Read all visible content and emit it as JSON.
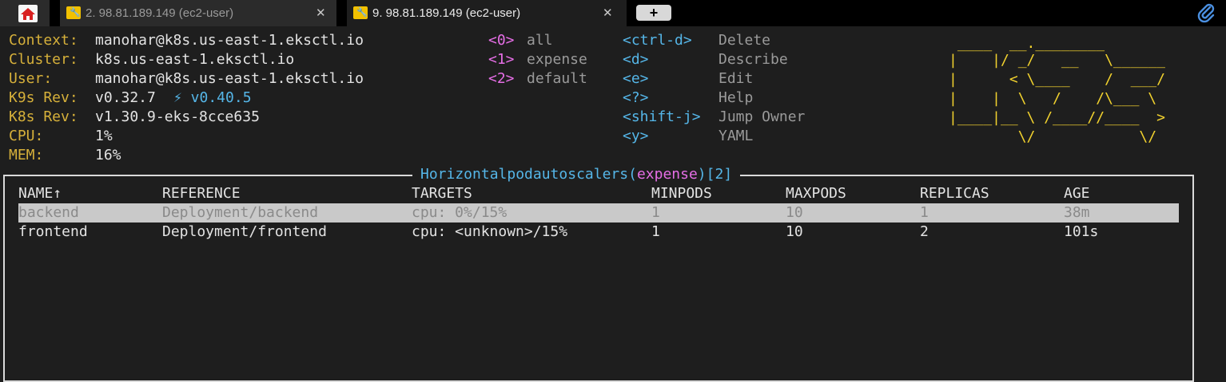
{
  "tabs": [
    {
      "label": "2. 98.81.189.149 (ec2-user)",
      "close": "✕"
    },
    {
      "label": "9. 98.81.189.149 (ec2-user)",
      "close": "✕"
    }
  ],
  "new_tab_label": "+",
  "info": [
    {
      "label": "Context:",
      "value": "manohar@k8s.us-east-1.eksctl.io"
    },
    {
      "label": "Cluster:",
      "value": "k8s.us-east-1.eksctl.io"
    },
    {
      "label": "User:",
      "value": "manohar@k8s.us-east-1.eksctl.io"
    },
    {
      "label": "K9s Rev:",
      "value": "v0.32.7",
      "extra": "⚡ v0.40.5"
    },
    {
      "label": "K8s Rev:",
      "value": "v1.30.9-eks-8cce635"
    },
    {
      "label": "CPU:",
      "value": "1%"
    },
    {
      "label": "MEM:",
      "value": "16%"
    }
  ],
  "namespaces": [
    {
      "key": "<0>",
      "name": "all"
    },
    {
      "key": "<1>",
      "name": "expense"
    },
    {
      "key": "<2>",
      "name": "default"
    }
  ],
  "shortcuts": [
    {
      "key": "<ctrl-d>",
      "action": "Delete"
    },
    {
      "key": "<d>",
      "action": "Describe"
    },
    {
      "key": "<e>",
      "action": "Edit"
    },
    {
      "key": "<?>",
      "action": "Help"
    },
    {
      "key": "<shift-j>",
      "action": "Jump Owner"
    },
    {
      "key": "<y>",
      "action": "YAML"
    }
  ],
  "logo_lines": [
    " ____  __.________       ",
    "|    |/ _/   __   \\______",
    "|      < \\____    /  ___/",
    "|    |  \\   /    /\\___ \\ ",
    "|____|__ \\ /____//____  >",
    "        \\/            \\/ "
  ],
  "table": {
    "title": "Horizontalpodautoscalers",
    "namespace": "expense",
    "count": "[2]",
    "columns": [
      "NAME↑",
      "REFERENCE",
      "TARGETS",
      "MINPODS",
      "MAXPODS",
      "REPLICAS",
      "AGE"
    ],
    "rows": [
      [
        "backend",
        "Deployment/backend",
        "cpu: 0%/15%",
        "1",
        "10",
        "1",
        "38m"
      ],
      [
        "frontend",
        "Deployment/frontend",
        "cpu: <unknown>/15%",
        "1",
        "10",
        "2",
        "101s"
      ]
    ]
  },
  "colors": {
    "label": "#d6b03a",
    "key": "#e66ee6",
    "shortcut_key": "#55b6e8",
    "logo": "#f2d22e",
    "background": "#1e1e1e"
  }
}
